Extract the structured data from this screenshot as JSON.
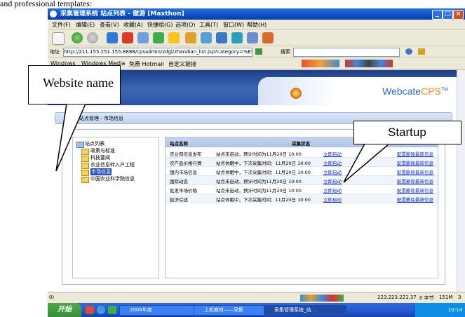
{
  "doc_text_top": "and professional templates:",
  "window": {
    "title": "采集管理系统 站点列表 - 傲游 [Maxthon]",
    "controls": {
      "minimize": "_",
      "maximize": "□",
      "close": "×"
    }
  },
  "menu": [
    "文件(F)",
    "编辑(E)",
    "查看(V)",
    "收藏(A)",
    "快捷组(G)",
    "选项(O)",
    "工具(T)",
    "窗口(W)",
    "帮助(H)"
  ],
  "address": {
    "label": "地址",
    "url": "http://211.155.251.155:8888/cpsadmin/zdgl/zhandian_list.jsp?category=%E5%B8%82%E"
  },
  "search_label": "搜索",
  "favorites": [
    "Windows",
    "Windows Media",
    "免费 Hotmail",
    "自定义链接"
  ],
  "page": {
    "brand": {
      "main": "Webcate",
      "accent": "CPS",
      "tm": "TM"
    },
    "breadcrumb": "采集站点管理 - 市场信息",
    "tree": {
      "root": "站点列表",
      "items": [
        "政策与标准",
        "科技要闻",
        "农业信息转入户工程",
        "市场信息",
        "中国农业科学院信息"
      ],
      "selected_index": 3
    },
    "table": {
      "headers": [
        "站点名称",
        "采集状态"
      ],
      "rows": [
        {
          "name": "农业部信息发布",
          "status": "站点未启动，预计时间为11月20日 10:00",
          "link": "立即启动",
          "actions": [
            "配置",
            "删除",
            "最新信息"
          ]
        },
        {
          "name": "农产品价格行情",
          "status": "站点休眠中，下次采集时间：11月20日 10:00",
          "link": "立即启动",
          "actions": [
            "配置",
            "删除",
            "最新信息"
          ]
        },
        {
          "name": "国内市场信息",
          "status": "站点休眠中，下次采集时间：11月20日 10:00",
          "link": "立即启动",
          "actions": [
            "配置",
            "删除",
            "最新信息"
          ]
        },
        {
          "name": "国际动态",
          "status": "站点未启动，预计时间为11月20日 10:00",
          "link": "立即启动",
          "actions": [
            "配置",
            "删除",
            "最新信息"
          ]
        },
        {
          "name": "批发市场价格",
          "status": "站点未启动，预计时间为11月20日 10:00",
          "link": "立即启动",
          "actions": [
            "配置",
            "删除",
            "最新信息"
          ]
        },
        {
          "name": "经济综述",
          "status": "站点休眠中，下次采集时间：11月20日 10:00",
          "link": "立即启动",
          "actions": [
            "配置",
            "删除",
            "最新信息"
          ]
        }
      ]
    }
  },
  "statusbar": {
    "left": "0)",
    "ip": "223.223.221.37",
    "bytes": "0 字节",
    "count": "151M",
    "page": "3"
  },
  "taskbar": {
    "start": "开始",
    "tasks": [
      "2006年度",
      "上机教材——采集",
      "采集管理系统_站..."
    ],
    "clock": "10:14"
  },
  "annotations": {
    "website_name": "Website name",
    "startup": "Startup"
  },
  "colors": {
    "banner_blue": "#2b54a6",
    "brand_blue": "#2b6bc0",
    "brand_orange": "#f08a1c",
    "link": "#1330c9"
  }
}
